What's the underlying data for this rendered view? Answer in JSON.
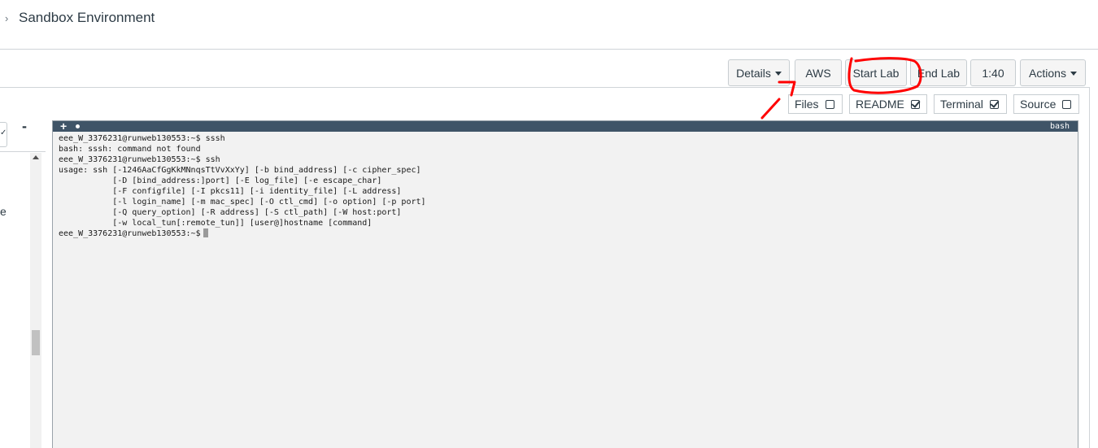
{
  "header": {
    "title": "Sandbox Environment",
    "chevron_icon": "chevron-right-icon"
  },
  "toolbar": {
    "details_label": "Details",
    "aws_label": "AWS",
    "start_lab_label": "Start Lab",
    "end_lab_label": "End Lab",
    "timer_label": "1:40",
    "actions_label": "Actions"
  },
  "toggles": [
    {
      "label": "Files",
      "checked": false
    },
    {
      "label": "README",
      "checked": true
    },
    {
      "label": "Terminal",
      "checked": true
    },
    {
      "label": "Source",
      "checked": false
    }
  ],
  "left_panel": {
    "minus_label": "-",
    "text_fragment": "e"
  },
  "terminal": {
    "tab_add_label": "+",
    "shell_label": "bash",
    "lines": [
      "eee_W_3376231@runweb130553:~$ sssh",
      "bash: sssh: command not found",
      "eee_W_3376231@runweb130553:~$ ssh",
      "usage: ssh [-1246AaCfGgKkMNnqsTtVvXxYy] [-b bind_address] [-c cipher_spec]",
      "           [-D [bind_address:]port] [-E log_file] [-e escape_char]",
      "           [-F configfile] [-I pkcs11] [-i identity_file] [-L address]",
      "           [-l login_name] [-m mac_spec] [-O ctl_cmd] [-o option] [-p port]",
      "           [-Q query_option] [-R address] [-S ctl_path] [-W host:port]",
      "           [-w local_tun[:remote_tun]] [user@]hostname [command]"
    ],
    "prompt": "eee_W_3376231@runweb130553:~$"
  },
  "colors": {
    "terminal_bar": "#3f5467",
    "terminal_bg": "#f2f2f2",
    "annotation": "#ff0000"
  }
}
